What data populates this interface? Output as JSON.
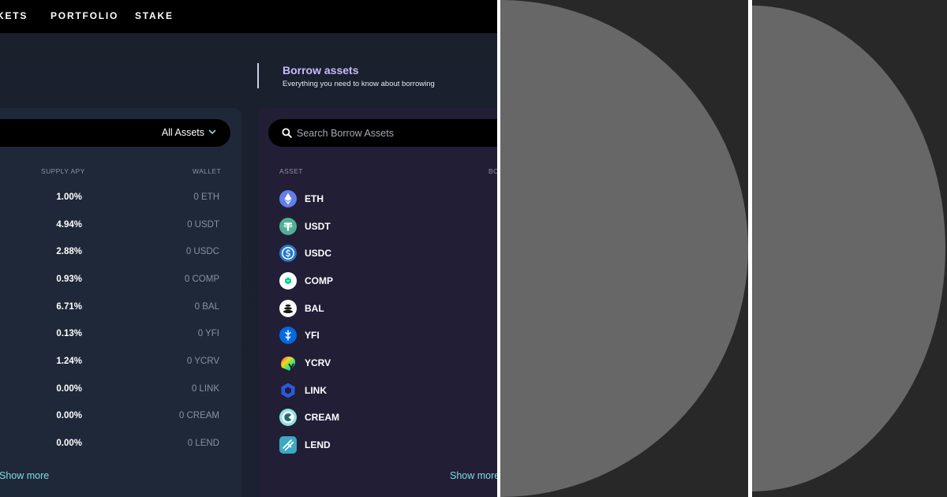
{
  "nav": {
    "items": [
      "KETS",
      "PORTFOLIO",
      "STAKE"
    ]
  },
  "borrow_header": {
    "title": "Borrow assets",
    "subtitle": "Everything you need to know about borrowing"
  },
  "supply": {
    "filter_label": "All Assets",
    "columns": {
      "apy": "SUPPLY APY",
      "wallet": "WALLET"
    },
    "rows": [
      {
        "apy": "1.00%",
        "wallet": "0 ETH"
      },
      {
        "apy": "4.94%",
        "wallet": "0 USDT"
      },
      {
        "apy": "2.88%",
        "wallet": "0 USDC"
      },
      {
        "apy": "0.93%",
        "wallet": "0 COMP"
      },
      {
        "apy": "6.71%",
        "wallet": "0 BAL"
      },
      {
        "apy": "0.13%",
        "wallet": "0 YFI"
      },
      {
        "apy": "1.24%",
        "wallet": "0 YCRV"
      },
      {
        "apy": "0.00%",
        "wallet": "0 LINK"
      },
      {
        "apy": "0.00%",
        "wallet": "0 CREAM"
      },
      {
        "apy": "0.00%",
        "wallet": "0 LEND"
      }
    ],
    "show_more": "Show more"
  },
  "borrow": {
    "search_placeholder": "Search Borrow Assets",
    "columns": {
      "asset": "ASSET",
      "cut": "BO"
    },
    "assets": [
      {
        "name": "ETH",
        "icon": "eth-icon",
        "color": "#627eea"
      },
      {
        "name": "USDT",
        "icon": "usdt-icon",
        "color": "#50af95"
      },
      {
        "name": "USDC",
        "icon": "usdc-icon",
        "color": "#2775ca"
      },
      {
        "name": "COMP",
        "icon": "comp-icon",
        "color": "#ffffff"
      },
      {
        "name": "BAL",
        "icon": "bal-icon",
        "color": "#ffffff"
      },
      {
        "name": "YFI",
        "icon": "yfi-icon",
        "color": "#006ae3"
      },
      {
        "name": "YCRV",
        "icon": "ycrv-icon",
        "color": "#f5a623"
      },
      {
        "name": "LINK",
        "icon": "link-icon",
        "color": "#2a5ada"
      },
      {
        "name": "CREAM",
        "icon": "cream-icon",
        "color": "#8fe1e3"
      },
      {
        "name": "LEND",
        "icon": "lend-icon",
        "color": "#3ba9c4"
      }
    ],
    "show_more": "Show more"
  },
  "colors": {
    "nav_bg": "#000000",
    "page_bg": "#1a202c",
    "supply_panel": "#1f2838",
    "borrow_panel": "#221e36",
    "accent_title": "#c9b8ff",
    "accent_link": "#7fdde4",
    "graphic_bg": "#282828",
    "graphic_circle": "#676767"
  }
}
